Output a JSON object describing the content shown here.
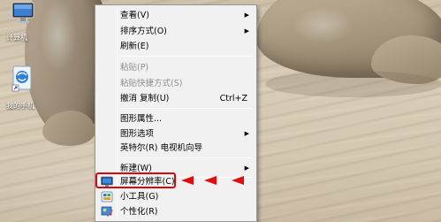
{
  "desktop": {
    "icons": [
      {
        "label": "计算机",
        "icon": "computer-icon"
      },
      {
        "label": "我的手机",
        "icon": "phone-icon"
      }
    ]
  },
  "menu": {
    "view": {
      "label": "查看(V)",
      "submenu": true
    },
    "sort": {
      "label": "排序方式(O)",
      "submenu": true
    },
    "refresh": {
      "label": "刷新(E)"
    },
    "paste": {
      "label": "粘贴(P)",
      "disabled": true
    },
    "paste_shortcut": {
      "label": "粘贴快捷方式(S)",
      "disabled": true
    },
    "undo_copy": {
      "label": "撤消 复制(U)",
      "shortcut": "Ctrl+Z"
    },
    "graphics_properties": {
      "label": "图形属性..."
    },
    "graphics_options": {
      "label": "图形选项",
      "submenu": true
    },
    "intel_tv_wizard": {
      "label": "英特尔(R) 电视机向导"
    },
    "new": {
      "label": "新建(W)",
      "submenu": true
    },
    "screen_resolution": {
      "label": "屏幕分辨率(C)",
      "icon": "display-icon",
      "highlighted": true
    },
    "gadgets": {
      "label": "小工具(G)",
      "icon": "gadgets-icon"
    },
    "personalize": {
      "label": "个性化(R)",
      "icon": "personalize-icon"
    }
  },
  "annotation": {
    "color": "#d10c0c",
    "arrow_count": 3
  }
}
